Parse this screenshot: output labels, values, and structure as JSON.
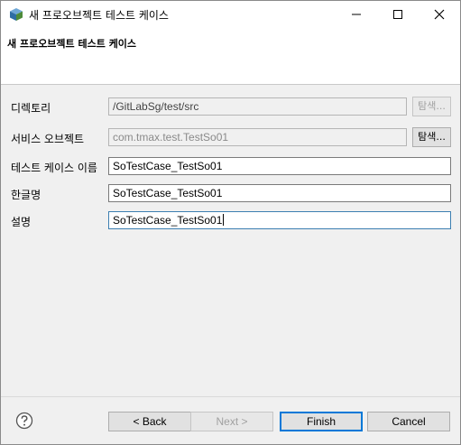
{
  "window": {
    "title": "새 프로오브젝트 테스트 케이스",
    "icons": {
      "app": "package-icon",
      "minimize": "minimize-icon",
      "maximize": "maximize-icon",
      "close": "close-icon"
    }
  },
  "banner": {
    "title": "새 프로오브젝트 테스트 케이스"
  },
  "form": {
    "directory": {
      "label": "디렉토리",
      "value": "/GitLabSg/test/src",
      "browse": "탐색..."
    },
    "service_object": {
      "label": "서비스 오브젝트",
      "value": "com.tmax.test.TestSo01",
      "browse": "탐색..."
    },
    "testcase_name": {
      "label": "테스트 케이스 이름",
      "value": "SoTestCase_TestSo01"
    },
    "korean_name": {
      "label": "한글명",
      "value": "SoTestCase_TestSo01"
    },
    "description": {
      "label": "설명",
      "value": "SoTestCase_TestSo01"
    }
  },
  "buttons": {
    "help": "help-icon",
    "back": "< Back",
    "next": "Next >",
    "finish": "Finish",
    "cancel": "Cancel"
  }
}
